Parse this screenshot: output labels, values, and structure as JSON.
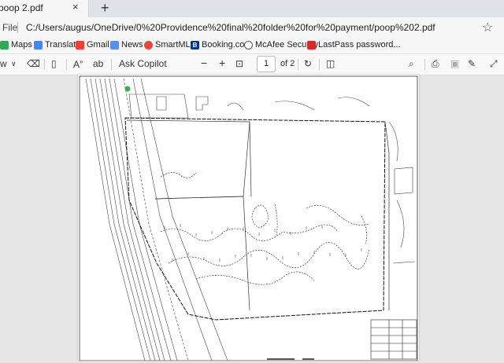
{
  "tab": {
    "title": "poop 2.pdf",
    "close_glyph": "×",
    "new_tab_glyph": "+"
  },
  "address_bar": {
    "scheme_label": "File",
    "url": "C:/Users/augus/OneDrive/0%20Providence%20final%20folder%20for%20payment/poop%202.pdf"
  },
  "bookmarks": [
    {
      "label": "Maps",
      "icon": "maps-icon",
      "color": "#34a853"
    },
    {
      "label": "Translate",
      "icon": "translate-icon",
      "color": "#4285f4"
    },
    {
      "label": "Gmail",
      "icon": "gmail-icon",
      "color": "#ea4335"
    },
    {
      "label": "News",
      "icon": "news-icon",
      "color": "#5b8def"
    },
    {
      "label": "SmartMLS",
      "icon": "smartmls-icon",
      "color": "#e8453c"
    },
    {
      "label": "Booking.com",
      "icon": "booking-icon",
      "color": "#003580"
    },
    {
      "label": "McAfee Security",
      "icon": "globe-icon",
      "color": "#555555"
    },
    {
      "label": "LastPass password...",
      "icon": "lastpass-icon",
      "color": "#d32d27"
    }
  ],
  "toolbar": {
    "view_label": "w",
    "ask_copilot": "Ask Copilot",
    "zoom_out": "−",
    "zoom_in": "+",
    "current_page": "1",
    "page_of": "of 2"
  },
  "document": {
    "name": "site survey plan page",
    "annotation_color": "#3cb043"
  }
}
